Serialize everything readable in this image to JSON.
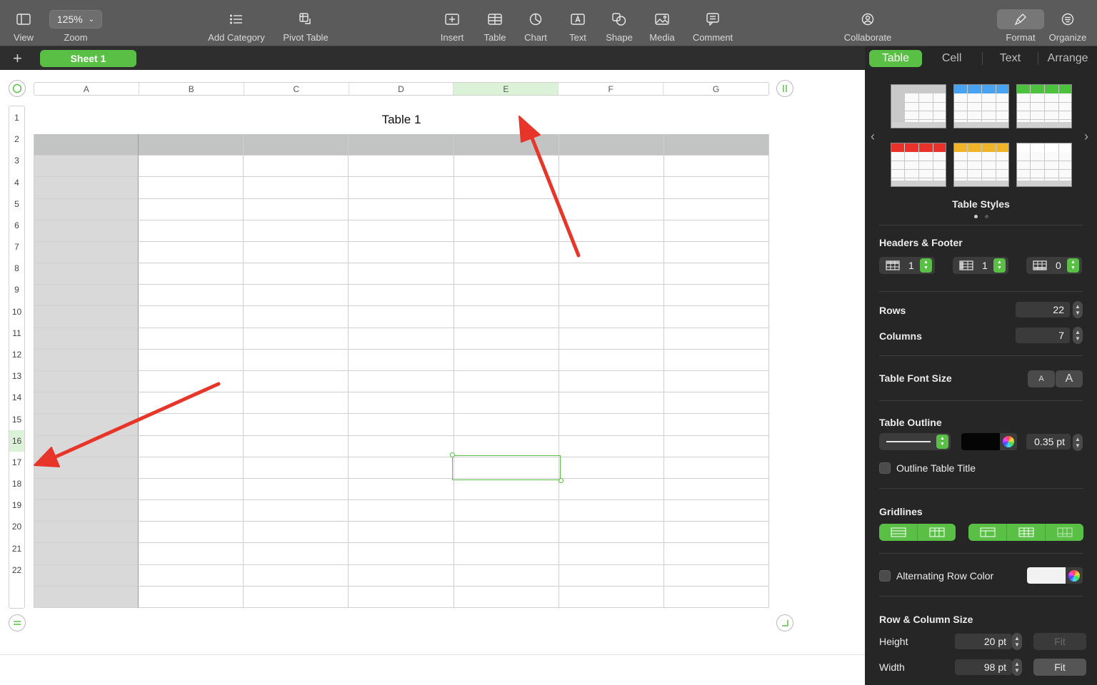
{
  "toolbar": {
    "view": "View",
    "zoom_value": "125%",
    "zoom": "Zoom",
    "add_category": "Add Category",
    "pivot_table": "Pivot Table",
    "insert": "Insert",
    "table": "Table",
    "chart": "Chart",
    "text": "Text",
    "shape": "Shape",
    "media": "Media",
    "comment": "Comment",
    "collaborate": "Collaborate",
    "format": "Format",
    "organize": "Organize"
  },
  "sheets": {
    "add": "+",
    "active": "Sheet 1"
  },
  "table": {
    "title": "Table 1",
    "columns": [
      "A",
      "B",
      "C",
      "D",
      "E",
      "F",
      "G"
    ],
    "rows": [
      "1",
      "2",
      "3",
      "4",
      "5",
      "6",
      "7",
      "8",
      "9",
      "10",
      "11",
      "12",
      "13",
      "14",
      "15",
      "16",
      "17",
      "18",
      "19",
      "20",
      "21",
      "22"
    ],
    "selected_column": "E",
    "selected_row": "16"
  },
  "sidebar": {
    "tabs": [
      "Table",
      "Cell",
      "Text",
      "Arrange"
    ],
    "table_styles_label": "Table Styles",
    "style_header_colors": [
      "#c9c9c9",
      "#4aa3f0",
      "#4cc13d",
      "#e8322b",
      "#f0b429",
      "#ffffff"
    ],
    "headers_footer_label": "Headers & Footer",
    "header_rows": "1",
    "header_columns": "1",
    "footer_rows": "0",
    "rows_label": "Rows",
    "rows_value": "22",
    "columns_label": "Columns",
    "columns_value": "7",
    "font_size_label": "Table Font Size",
    "font_small": "A",
    "font_large": "A",
    "outline_label": "Table Outline",
    "outline_width": "0.35 pt",
    "outline_title_label": "Outline Table Title",
    "gridlines_label": "Gridlines",
    "alt_row_label": "Alternating Row Color",
    "row_col_size_label": "Row & Column Size",
    "height_label": "Height",
    "height_value": "20 pt",
    "width_label": "Width",
    "width_value": "98 pt",
    "fit": "Fit"
  },
  "colors": {
    "accent": "#59c045",
    "annotation_arrow": "#e8352a"
  }
}
